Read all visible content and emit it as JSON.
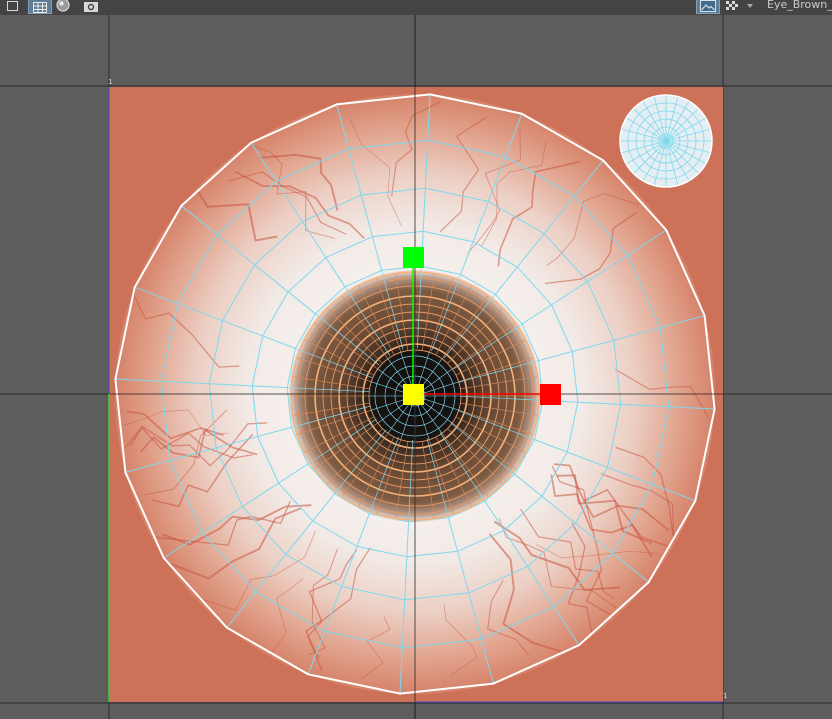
{
  "toolbar": {
    "buttons": [
      {
        "id": "display-toggle",
        "icon": "square-frame-icon",
        "active": false
      },
      {
        "id": "grid-toggle",
        "icon": "grid-icon",
        "active": true
      },
      {
        "id": "shaded-toggle",
        "icon": "sphere-icon",
        "active": false
      },
      {
        "id": "snapshot",
        "icon": "camera-icon",
        "active": false
      }
    ],
    "right_buttons": [
      {
        "id": "image-display",
        "icon": "image-icon",
        "active": true
      },
      {
        "id": "checker-toggle",
        "icon": "checker-icon",
        "active": false
      },
      {
        "id": "texture-dropdown",
        "icon": "chevron-down-icon",
        "active": false
      }
    ],
    "texture_name": "Eye_Brown_"
  },
  "colors": {
    "background": "#5d5d5d",
    "toolbar": "#444444",
    "uv_backdrop": "#cd7158",
    "uv_wire": "#7fd8ee",
    "uv_border": "#ffffff",
    "iris_wire": "#f2a46b",
    "manip_y": "#00ff00",
    "manip_x": "#ff0000",
    "manip_center": "#ffff00"
  }
}
